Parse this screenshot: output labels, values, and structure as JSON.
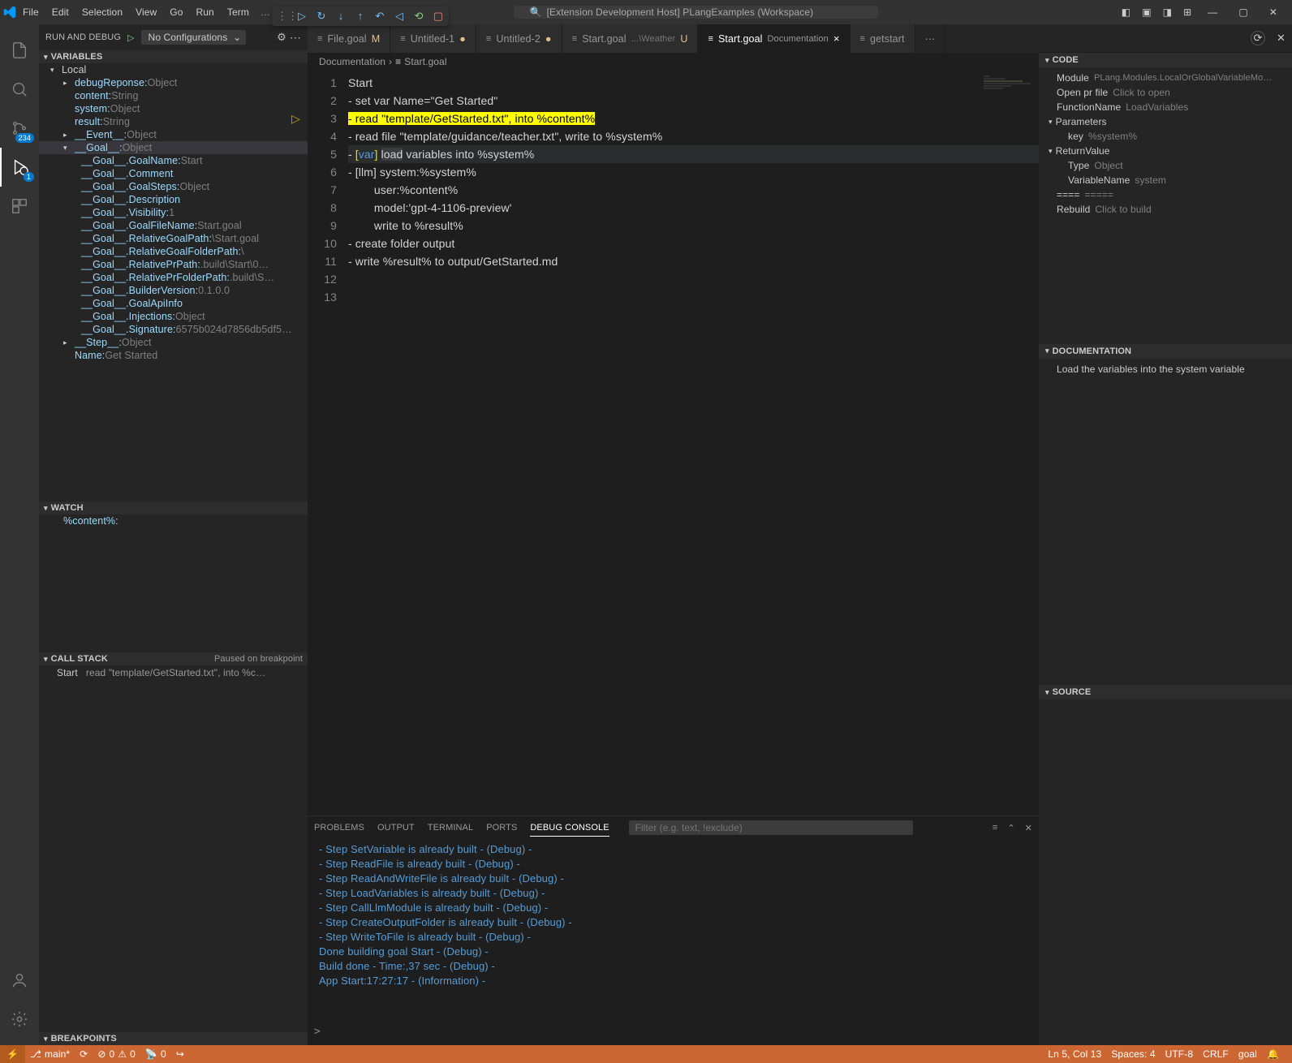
{
  "title": "[Extension Development Host] PLangExamples (Workspace)",
  "menu": [
    "File",
    "Edit",
    "Selection",
    "View",
    "Go",
    "Run",
    "Term"
  ],
  "activitybar": {
    "badges": {
      "sourceControl": "234",
      "debug": "1"
    }
  },
  "debugHeader": {
    "title": "RUN AND DEBUG",
    "config": "No Configurations"
  },
  "variables": {
    "head": "VARIABLES",
    "local": "Local",
    "items": {
      "debugResponse": {
        "k": "debugReponse:",
        "v": "Object"
      },
      "content": {
        "k": "content:",
        "v": "String"
      },
      "system": {
        "k": "system:",
        "v": "Object"
      },
      "result": {
        "k": "result:",
        "v": "String"
      },
      "event": {
        "k": "__Event__:",
        "v": "Object"
      },
      "goal": {
        "k": "__Goal__:",
        "v": "Object"
      },
      "goalName": {
        "k": "__Goal__.GoalName:",
        "v": "Start"
      },
      "comment": {
        "k": "__Goal__.Comment"
      },
      "goalSteps": {
        "k": "__Goal__.GoalSteps:",
        "v": "Object"
      },
      "description": {
        "k": "__Goal__.Description"
      },
      "visibility": {
        "k": "__Goal__.Visibility:",
        "v": "1"
      },
      "goalFileName": {
        "k": "__Goal__.GoalFileName:",
        "v": "Start.goal"
      },
      "relGoalPath": {
        "k": "__Goal__.RelativeGoalPath:",
        "v": "\\Start.goal"
      },
      "relGoalFolderPath": {
        "k": "__Goal__.RelativeGoalFolderPath:",
        "v": "\\"
      },
      "relPrPath": {
        "k": "__Goal__.RelativePrPath:",
        "v": ".build\\Start\\0…"
      },
      "relPrFolderPath": {
        "k": "__Goal__.RelativePrFolderPath:",
        "v": ".build\\S…"
      },
      "builderVersion": {
        "k": "__Goal__.BuilderVersion:",
        "v": "0.1.0.0"
      },
      "goalApiInfo": {
        "k": "__Goal__.GoalApiInfo"
      },
      "injections": {
        "k": "__Goal__.Injections:",
        "v": "Object"
      },
      "signature": {
        "k": "__Goal__.Signature:",
        "v": "6575b024d7856db5df5…"
      },
      "step": {
        "k": "__Step__:",
        "v": "Object"
      },
      "name": {
        "k": "Name:",
        "v": "Get Started"
      }
    }
  },
  "watch": {
    "head": "WATCH",
    "items": [
      {
        "expr": "%content%:"
      }
    ]
  },
  "callstack": {
    "head": "CALL STACK",
    "status": "Paused on breakpoint",
    "items": [
      {
        "name": "Start",
        "detail": "read \"template/GetStarted.txt\", into %c…"
      }
    ]
  },
  "breakpoints": {
    "head": "BREAKPOINTS"
  },
  "tabs": [
    {
      "label": "File.goal",
      "suffix": "M",
      "dirty": false
    },
    {
      "label": "Untitled-1",
      "dirty": true
    },
    {
      "label": "Untitled-2",
      "dirty": true
    },
    {
      "label": "Start.goal",
      "path": "...\\Weather",
      "suffix": "U",
      "dirty": false
    },
    {
      "label": "Start.goal",
      "path": "Documentation",
      "dirty": false,
      "active": true,
      "close": true
    },
    {
      "label": "getstart",
      "overflow": true
    }
  ],
  "breadcrumb": {
    "folder": "Documentation",
    "file": "Start.goal"
  },
  "code": {
    "lines": [
      "Start",
      "- set var Name=\"Get Started\"",
      "- read \"template/GetStarted.txt\", into %content%",
      "- read file \"template/guidance/teacher.txt\", write to %system%",
      "- [var] load variables into %system%",
      "- [llm] system:%system%",
      "        user:%content%",
      "        model:'gpt-4-1106-preview'",
      "        write to %result%",
      "- create folder output",
      "- write %result% to output/GetStarted.md",
      "",
      ""
    ],
    "highlightLine": 3
  },
  "panel": {
    "tabs": [
      "PROBLEMS",
      "OUTPUT",
      "TERMINAL",
      "PORTS",
      "DEBUG CONSOLE"
    ],
    "active": "DEBUG CONSOLE",
    "filterPlaceholder": "Filter (e.g. text, !exclude)",
    "lines": [
      "- Step SetVariable is already built - (Debug) -",
      "- Step ReadFile is already built - (Debug) -",
      "- Step ReadAndWriteFile is already built - (Debug) -",
      "- Step LoadVariables is already built - (Debug) -",
      "- Step CallLlmModule is already built - (Debug) -",
      "- Step CreateOutputFolder is already built - (Debug) -",
      "- Step WriteToFile is already built - (Debug) -",
      "Done building goal Start - (Debug) -",
      "",
      "Build done - Time:,37 sec - (Debug) -",
      "App Start:17:27:17 - (Information) -"
    ],
    "prompt": ">"
  },
  "rightpane": {
    "code": {
      "head": "CODE",
      "module": {
        "label": "Module",
        "value": "PLang.Modules.LocalOrGlobalVariableMo…"
      },
      "openPr": {
        "label": "Open pr file",
        "value": "Click to open"
      },
      "functionName": {
        "label": "FunctionName",
        "value": "LoadVariables"
      },
      "parameters": {
        "label": "Parameters"
      },
      "paramKey": {
        "label": "key",
        "value": "%system%"
      },
      "returnValue": {
        "label": "ReturnValue"
      },
      "type": {
        "label": "Type",
        "value": "Object"
      },
      "variableName": {
        "label": "VariableName",
        "value": "system"
      },
      "sep": {
        "label": "====",
        "value": "====="
      },
      "rebuild": {
        "label": "Rebuild",
        "value": "Click to build"
      }
    },
    "documentation": {
      "head": "DOCUMENTATION",
      "text": "Load the variables into the system variable"
    },
    "source": {
      "head": "SOURCE"
    }
  },
  "statusbar": {
    "branch": "main*",
    "errors": "0",
    "warnings": "0",
    "ports": "0",
    "cursor": "Ln 5, Col 13",
    "spaces": "Spaces: 4",
    "encoding": "UTF-8",
    "eol": "CRLF",
    "lang": "goal"
  }
}
